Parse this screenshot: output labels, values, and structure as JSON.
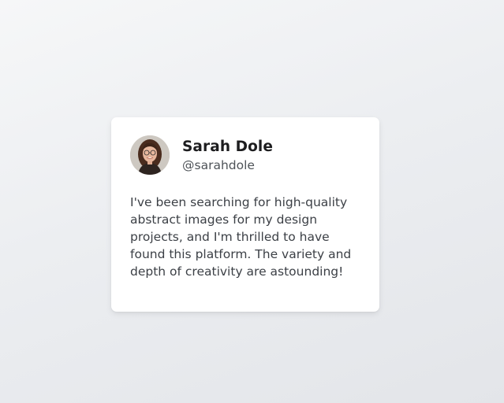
{
  "testimonial": {
    "author": {
      "name": "Sarah Dole",
      "handle": "@sarahdole",
      "avatar_icon": "user-photo-avatar"
    },
    "quote": "I've been searching for high-quality abstract images for my design projects, and I'm thrilled to have found this platform. The variety and depth of creativity are astounding!"
  },
  "colors": {
    "background": "#eceef1",
    "card": "#ffffff",
    "name_text": "#1d1d1f",
    "body_text": "#3c4046"
  }
}
